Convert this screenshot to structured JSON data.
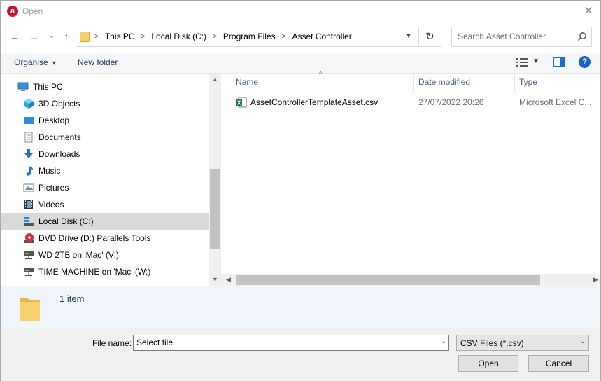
{
  "window": {
    "title": "Open",
    "app_icon_letter": "a",
    "close_label": "✕"
  },
  "nav_buttons": {
    "back": "←",
    "forward": "→",
    "recent": "⌄",
    "up": "↑"
  },
  "breadcrumbs": [
    "This PC",
    "Local Disk (C:)",
    "Program Files",
    "Asset Controller"
  ],
  "breadcrumb_separator": ">",
  "search": {
    "placeholder": "Search Asset Controller"
  },
  "toolbar": {
    "organise_label": "Organise",
    "organise_arrow": "▾",
    "new_folder_label": "New folder",
    "help_label": "?"
  },
  "nav_pane": {
    "items": [
      {
        "label": "This PC",
        "icon": "computer-icon"
      },
      {
        "label": "3D Objects",
        "icon": "3d-objects-icon"
      },
      {
        "label": "Desktop",
        "icon": "desktop-icon"
      },
      {
        "label": "Documents",
        "icon": "documents-icon"
      },
      {
        "label": "Downloads",
        "icon": "downloads-icon"
      },
      {
        "label": "Music",
        "icon": "music-icon"
      },
      {
        "label": "Pictures",
        "icon": "pictures-icon"
      },
      {
        "label": "Videos",
        "icon": "videos-icon"
      },
      {
        "label": "Local Disk (C:)",
        "icon": "local-disk-icon",
        "selected": true
      },
      {
        "label": "DVD Drive (D:) Parallels Tools",
        "icon": "dvd-drive-icon"
      },
      {
        "label": "WD 2TB on 'Mac' (V:)",
        "icon": "network-drive-icon"
      },
      {
        "label": "TIME MACHINE on 'Mac' (W:)",
        "icon": "network-drive-icon"
      }
    ]
  },
  "columns": {
    "name": "Name",
    "date": "Date modified",
    "type": "Type"
  },
  "files": [
    {
      "name": "AssetControllerTemplateAsset.csv",
      "date": "27/07/2022 20:26",
      "type": "Microsoft Excel C..."
    }
  ],
  "details": {
    "count": "1 item"
  },
  "bottom": {
    "file_name_label": "File name:",
    "file_name_value": "Select file",
    "filter_value": "CSV Files (*.csv)",
    "open_label": "Open",
    "cancel_label": "Cancel"
  },
  "colors": {
    "accent": "#1565c0",
    "selected_bg": "#d9d9d9",
    "details_bg": "#eff5fb"
  }
}
